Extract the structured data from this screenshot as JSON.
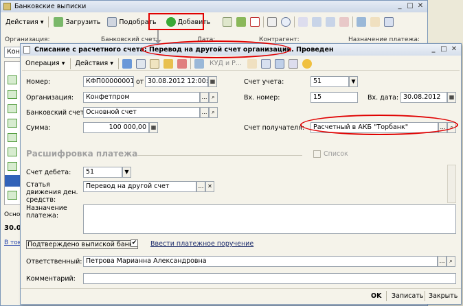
{
  "bg_window": {
    "title": "Банковские выписки",
    "toolbar": {
      "actions": "Действия",
      "load": "Загрузить",
      "select": "Подобрать",
      "add": "Добавить"
    },
    "columns": [
      "Организация:",
      "Банковский счет:",
      "Дата:",
      "Контрагент:",
      "Назначение платежа:"
    ],
    "col_value": "Кон",
    "side_label": "Осно",
    "side_value": "30.0",
    "side_link": "В тов"
  },
  "form": {
    "title": "Списание с расчетного счета: Перевод на другой счет организации. Проведен",
    "toolbar": {
      "operation": "Операция",
      "actions": "Действия",
      "kudir": "КУД и Р..."
    },
    "number_label": "Номер:",
    "number": "КФП00000001",
    "from_label": "от",
    "date": "30.08.2012 12:00:00",
    "org_label": "Организация:",
    "org": "Конфетпром",
    "bank_label": "Банковский счет:",
    "bank": "Основной счет",
    "sum_label": "Сумма:",
    "sum": "100 000,00",
    "acct_label": "Счет учета:",
    "acct": "51",
    "inno_label": "Вх. номер:",
    "inno": "15",
    "indate_label": "Вх. дата:",
    "indate": "30.08.2012",
    "recipient_label": "Счет получателя:",
    "recipient": "Расчетный в АКБ \"Торбанк\"",
    "section_title": "Расшифровка платежа",
    "list_label": "Список",
    "debit_label": "Счет дебета:",
    "debit": "51",
    "cashflow_label": "Статья движения ден. средств:",
    "cashflow": "Перевод на другой счет",
    "purpose_label": "Назначение платежа:",
    "purpose": "",
    "confirmed_label": "Подтверждено выпиской банка",
    "confirmed_mark": "✔",
    "enter_order": "Ввести платежное поручение",
    "responsible_label": "Ответственный:",
    "responsible": "Петрова Марианна Александровна",
    "comment_label": "Комментарий:",
    "comment": "",
    "ok": "OK",
    "save": "Записать",
    "close": "Закрыть"
  }
}
